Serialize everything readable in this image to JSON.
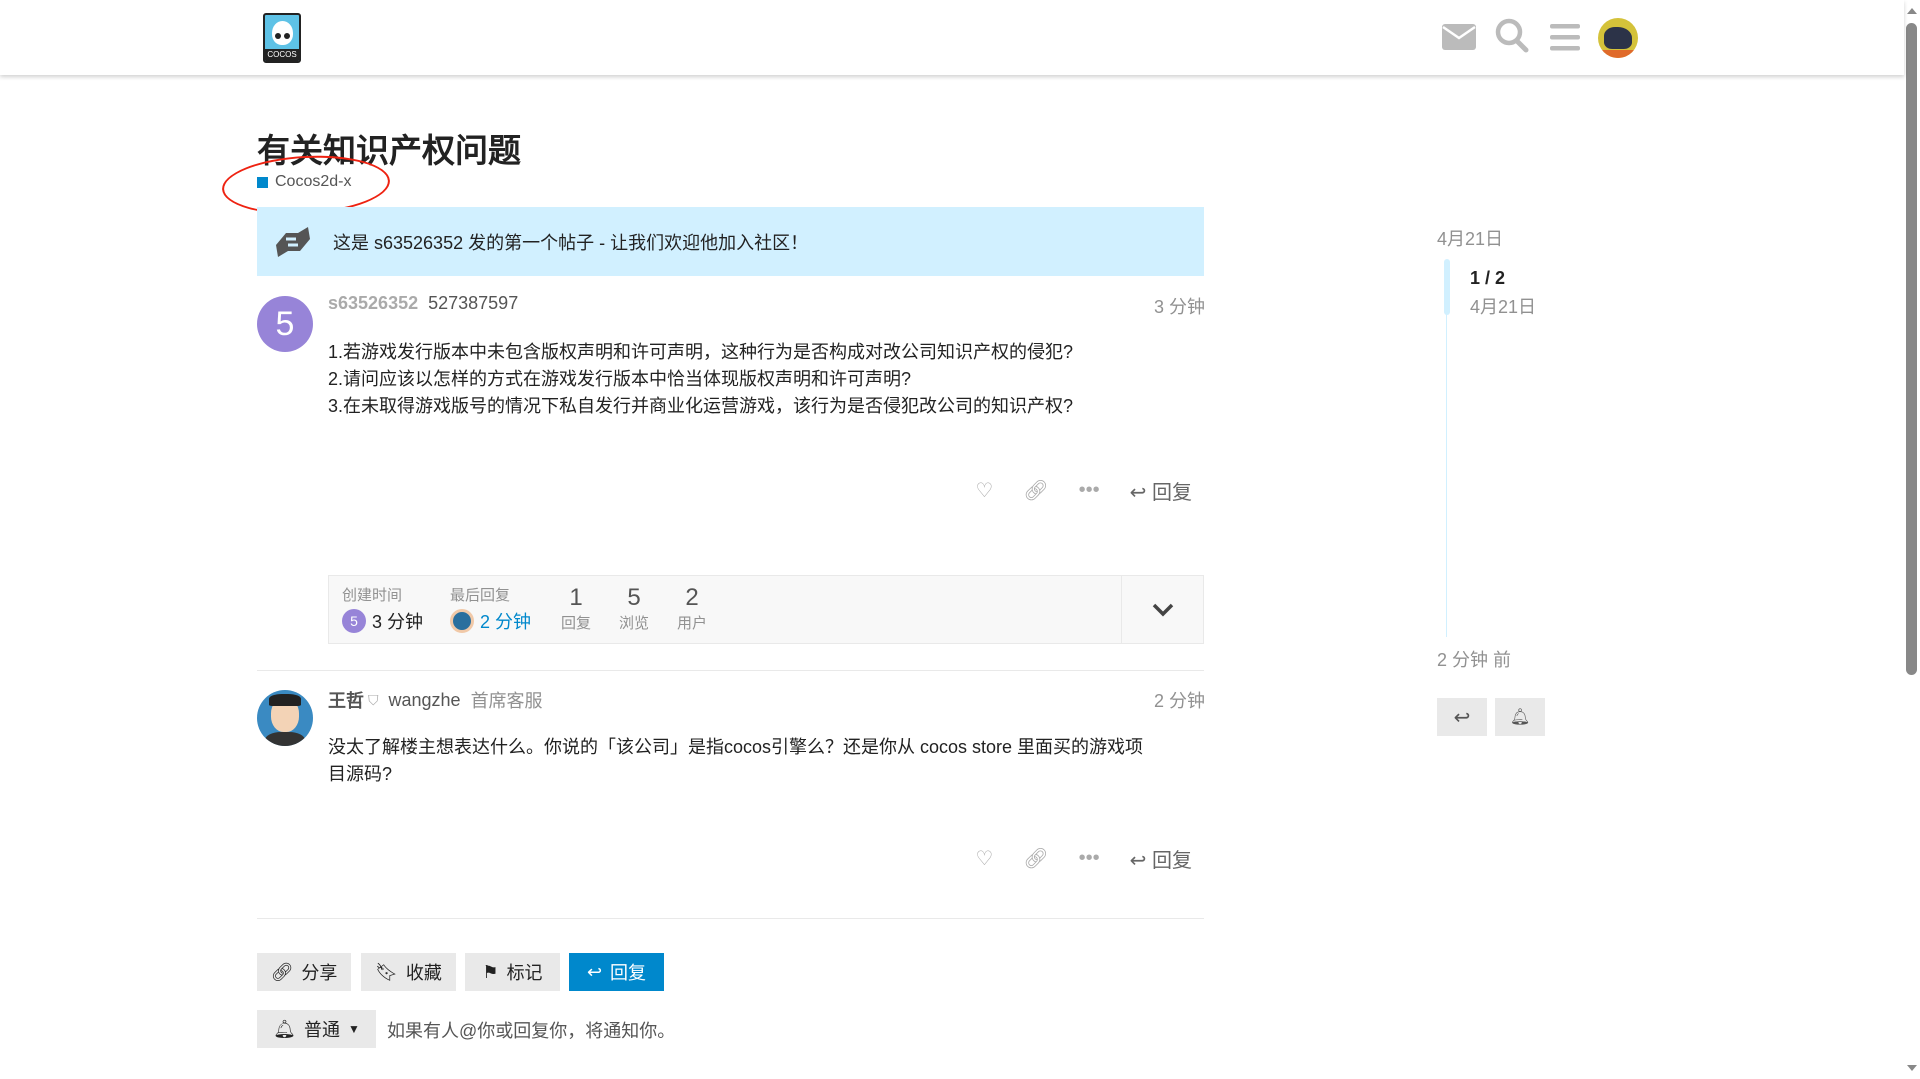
{
  "header": {
    "logo_text": "COCOS",
    "icons": [
      "envelope-icon",
      "search-icon",
      "hamburger-icon",
      "user-avatar"
    ]
  },
  "topic": {
    "title": "有关知识产权问题",
    "category": "Cocos2d-x",
    "category_color": "#0088cc"
  },
  "banner": {
    "text": "这是 s63526352 发的第一个帖子 - 让我们欢迎他加入社区！"
  },
  "posts": [
    {
      "avatar_letter": "5",
      "username": "s63526352",
      "fullname": "527387597",
      "time": "3 分钟",
      "lines": [
        "1.若游戏发行版本中未包含版权声明和许可声明，这种行为是否构成对改公司知识产权的侵犯?",
        "2.请问应该以怎样的方式在游戏发行版本中恰当体现版权声明和许可声明?",
        "3.在未取得游戏版号的情况下私自发行并商业化运营游戏，该行为是否侵犯改公司的知识产权?"
      ],
      "reply_label": "回复"
    },
    {
      "username": "王哲",
      "fullname": "wangzhe",
      "title": "首席客服",
      "time": "2 分钟",
      "lines": [
        "没太了解楼主想表达什么。你说的「该公司」是指cocos引擎么？还是你从 cocos store 里面买的游戏项",
        "目源码?"
      ],
      "reply_label": "回复"
    }
  ],
  "topic_map": {
    "created_label": "创建时间",
    "created_avatar": "5",
    "created_time": "3 分钟",
    "last_label": "最后回复",
    "last_time": "2 分钟",
    "stats": [
      {
        "value": "1",
        "label": "回复"
      },
      {
        "value": "5",
        "label": "浏览"
      },
      {
        "value": "2",
        "label": "用户"
      }
    ]
  },
  "footer": {
    "share": "分享",
    "bookmark": "收藏",
    "flag": "标记",
    "reply": "回复",
    "notify_level": "普通",
    "notify_desc": "如果有人@你或回复你，将通知你。"
  },
  "timeline": {
    "start_date": "4月21日",
    "position": "1 / 2",
    "position_date": "4月21日",
    "end": "2 分钟 前",
    "progress": 0.5
  }
}
